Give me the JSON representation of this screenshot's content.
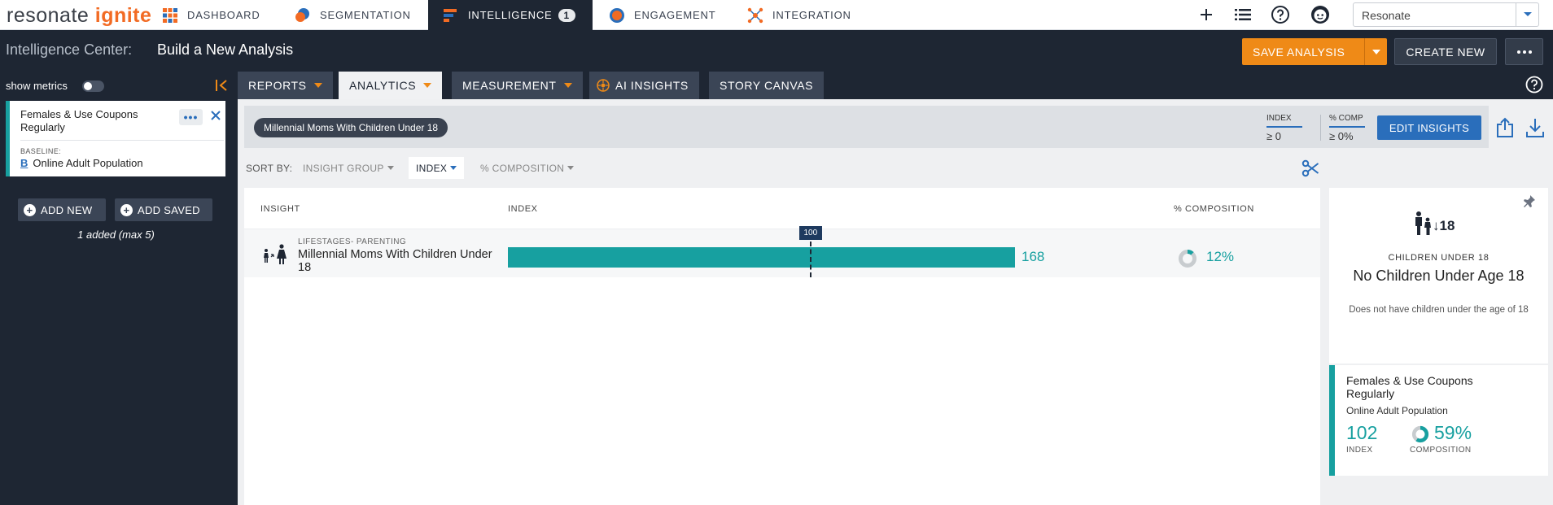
{
  "brand": {
    "part1": "resonate",
    "part2": "ignite"
  },
  "nav": {
    "items": [
      {
        "label": "DASHBOARD",
        "icon": "dashboard-grid-icon"
      },
      {
        "label": "SEGMENTATION",
        "icon": "segmentation-icon"
      },
      {
        "label": "INTELLIGENCE",
        "icon": "intelligence-icon",
        "badge": "1",
        "active": true
      },
      {
        "label": "ENGAGEMENT",
        "icon": "engagement-target-icon"
      },
      {
        "label": "INTEGRATION",
        "icon": "integration-network-icon"
      }
    ],
    "account_value": "Resonate"
  },
  "header": {
    "section": "Intelligence Center:",
    "title": "Build a New Analysis",
    "save_label": "SAVE ANALYSIS",
    "create_label": "CREATE NEW"
  },
  "sidebar": {
    "show_metrics_label": "show metrics",
    "audience": {
      "name": "Females & Use Coupons Regularly",
      "baseline_label": "BASELINE:",
      "baseline_badge": "B",
      "baseline_value": "Online Adult Population"
    },
    "add_new_label": "ADD NEW",
    "add_saved_label": "ADD SAVED",
    "added_text": "1 added (max 5)"
  },
  "subtabs": [
    {
      "label": "REPORTS",
      "caret": true
    },
    {
      "label": "ANALYTICS",
      "caret": true,
      "active": true
    },
    {
      "label": "MEASUREMENT",
      "caret": true
    },
    {
      "label": "AI INSIGHTS",
      "caret": false
    },
    {
      "label": "STORY CANVAS",
      "caret": false
    }
  ],
  "insights": {
    "pill": "Millennial Moms With Children Under 18",
    "filters": [
      {
        "label": "INDEX",
        "value": "≥ 0"
      },
      {
        "label": "% COMP",
        "value": "≥ 0%"
      }
    ],
    "edit_label": "EDIT INSIGHTS"
  },
  "sort": {
    "label": "SORT BY:",
    "options": [
      {
        "label": "INSIGHT GROUP",
        "active": false
      },
      {
        "label": "INDEX",
        "active": true
      },
      {
        "label": "% COMPOSITION",
        "active": false
      }
    ]
  },
  "table": {
    "headers": {
      "insight": "INSIGHT",
      "index": "INDEX",
      "composition": "% COMPOSITION"
    },
    "baseline_value": "100",
    "rows": [
      {
        "category": "LIFESTAGES- PARENTING",
        "name": "Millennial Moms With Children Under 18",
        "index": 168,
        "index_label": "168",
        "composition": 0.12,
        "composition_label": "12%"
      }
    ],
    "index_axis_max": 168
  },
  "detail": {
    "icon_text": "↓18",
    "category": "CHILDREN UNDER 18",
    "title": "No Children Under Age 18",
    "description": "Does not have children under the age of 18"
  },
  "audience_summary": {
    "title": "Females & Use Coupons Regularly",
    "subtitle": "Online Adult Population",
    "index_value": "102",
    "index_label": "INDEX",
    "composition_value": "59%",
    "composition_fraction": 0.59,
    "composition_label": "COMPOSITION"
  },
  "colors": {
    "accent_teal": "#17a0a0",
    "brand_orange": "#ef8a17",
    "blue": "#2a6ebb",
    "navy": "#1e2633"
  }
}
